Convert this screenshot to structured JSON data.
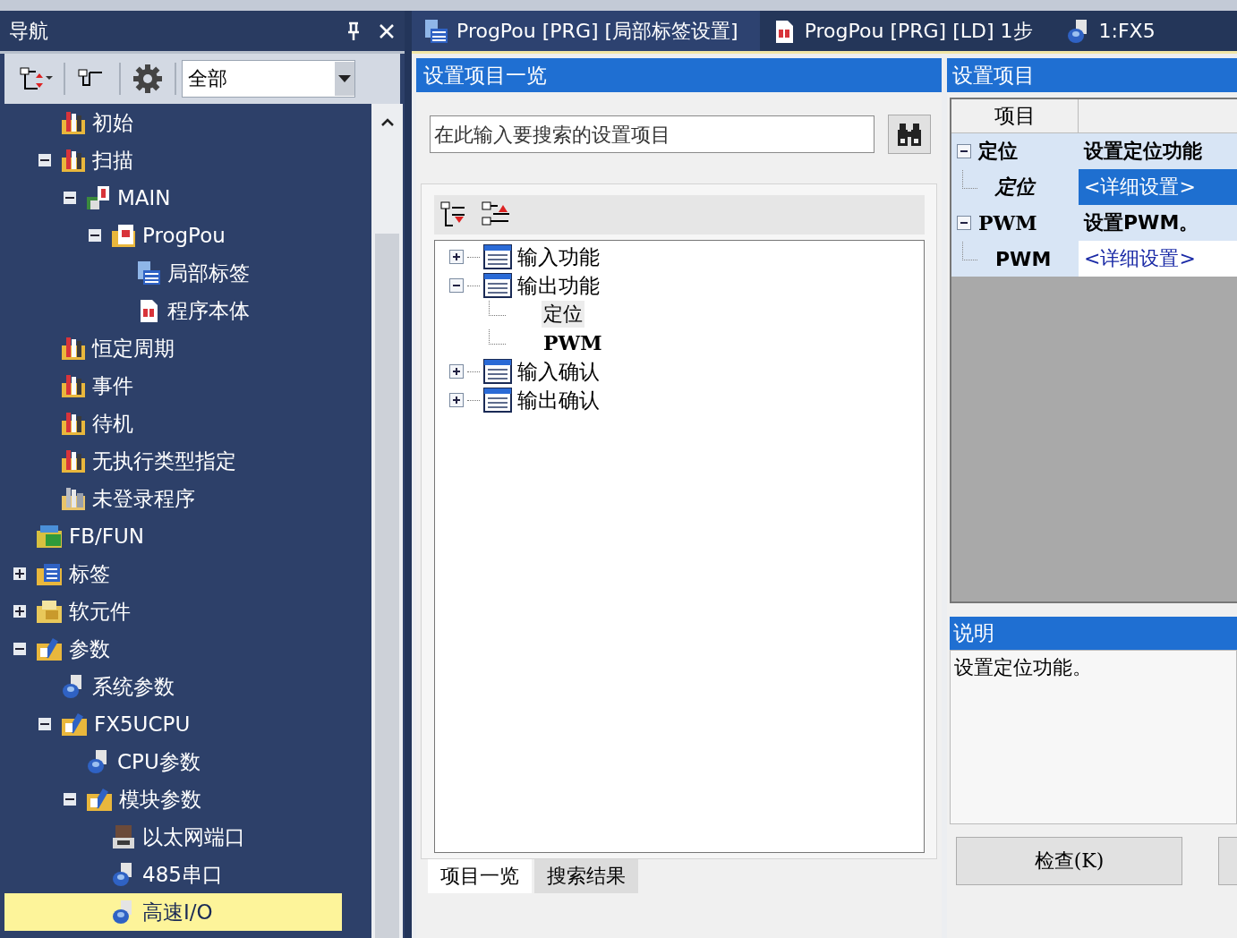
{
  "top_tabs": [
    {
      "label": "ProgPou [PRG] [局部标签设置]",
      "kind": "labels",
      "selected": true
    },
    {
      "label": "ProgPou [PRG] [LD] 1步",
      "kind": "program",
      "selected": false
    },
    {
      "label": "1:FX5",
      "kind": "parameter",
      "selected": false
    }
  ],
  "nav": {
    "title": "导航",
    "filter": "全部",
    "branch_items": [
      {
        "label": "初始",
        "kind": "task",
        "selected": false
      },
      {
        "label": "扫描",
        "kind": "task",
        "expanded": true,
        "selected": false,
        "children": [
          {
            "label": "MAIN",
            "kind": "program-group",
            "expanded": true,
            "selected": false,
            "children": [
              {
                "label": "ProgPou",
                "kind": "pou",
                "expanded": true,
                "selected": false,
                "children": [
                  {
                    "label": "局部标签",
                    "kind": "labels",
                    "selected": false
                  },
                  {
                    "label": "程序本体",
                    "kind": "program",
                    "selected": false
                  }
                ]
              }
            ]
          }
        ]
      },
      {
        "label": "恒定周期",
        "kind": "task",
        "selected": false
      },
      {
        "label": "事件",
        "kind": "task",
        "selected": false
      },
      {
        "label": "待机",
        "kind": "task",
        "selected": false
      },
      {
        "label": "无执行类型指定",
        "kind": "task",
        "selected": false
      },
      {
        "label": "未登录程序",
        "kind": "unregistered",
        "selected": false
      }
    ],
    "tree_items": [
      {
        "label": "FB/FUN",
        "kind": "fb",
        "selected": false
      },
      {
        "label": "标签",
        "kind": "labels-folder",
        "expanded": false,
        "selected": false
      },
      {
        "label": "软元件",
        "kind": "devices",
        "expanded": false,
        "selected": false
      },
      {
        "label": "参数",
        "kind": "parameters",
        "expanded": true,
        "selected": false,
        "children": [
          {
            "label": "系统参数",
            "kind": "parameter",
            "selected": false
          },
          {
            "label": "FX5UCPU",
            "kind": "parameters",
            "expanded": true,
            "selected": false,
            "children": [
              {
                "label": "CPU参数",
                "kind": "parameter",
                "selected": false
              },
              {
                "label": "模块参数",
                "kind": "parameters",
                "expanded": true,
                "selected": false,
                "children": [
                  {
                    "label": "以太网端口",
                    "kind": "ethernet",
                    "selected": false
                  },
                  {
                    "label": "485串口",
                    "kind": "parameter",
                    "selected": false
                  },
                  {
                    "label": "高速I/O",
                    "kind": "parameter",
                    "selected": true
                  }
                ]
              }
            ]
          }
        ]
      }
    ]
  },
  "settings_list": {
    "title": "设置项目一览",
    "search": {
      "placeholder": "在此输入要搜索的设置项目"
    },
    "items": [
      {
        "label": "输入功能",
        "expanded": false
      },
      {
        "label": "输出功能",
        "expanded": true,
        "children": [
          {
            "label": "定位",
            "selected": true
          },
          {
            "label": "PWM",
            "selected": false
          }
        ]
      },
      {
        "label": "输入确认",
        "expanded": false
      },
      {
        "label": "输出确认",
        "expanded": false
      }
    ],
    "tabs": [
      {
        "label": "项目一览",
        "selected": true
      },
      {
        "label": "搜索结果",
        "selected": false
      }
    ]
  },
  "settings": {
    "title": "设置项目",
    "header": "项目",
    "groups": [
      {
        "label": "定位",
        "description": "设置定位功能",
        "expanded": true,
        "children": [
          {
            "label": "定位",
            "value": "<详细设置>",
            "selected": true
          }
        ]
      },
      {
        "label": "PWM",
        "description": "设置PWM。",
        "expanded": true,
        "children": [
          {
            "label": "PWM",
            "value": "<详细设置>",
            "selected": false
          }
        ]
      }
    ]
  },
  "description": {
    "title": "说明",
    "text": "设置定位功能。"
  },
  "buttons": [
    {
      "label": "检查(K)"
    }
  ]
}
